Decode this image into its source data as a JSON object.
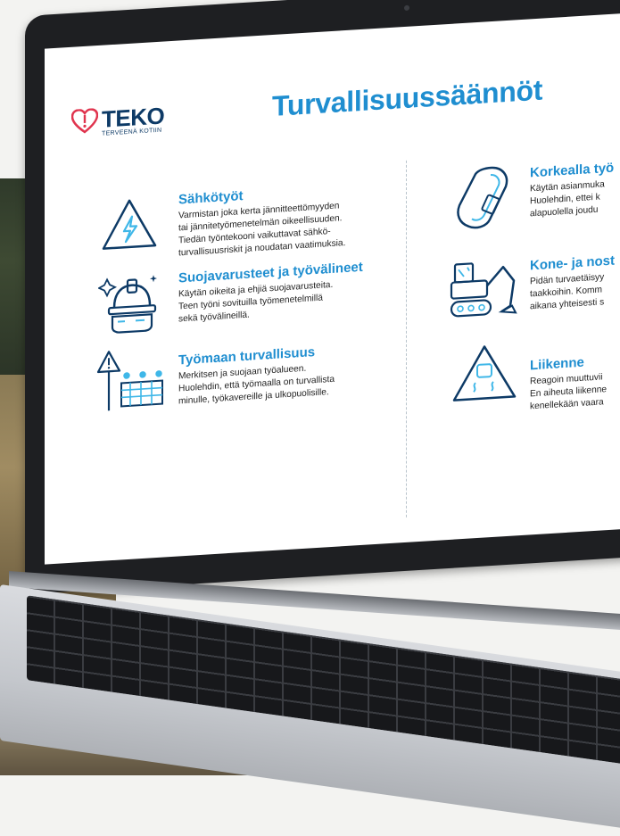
{
  "slide": {
    "logo": {
      "word": "TEKO",
      "tagline": "TERVEENÄ KOTIIN"
    },
    "title": "Turvallisuussäännöt",
    "left_column": [
      {
        "heading": "Sähkötyöt",
        "icon": "electric-hazard-icon",
        "lines": [
          "Varmistan joka kerta jännitteettömyyden",
          "tai jännitetyömenetelmän oikeellisuuden.",
          "Tiedän työntekooni vaikuttavat sähkö-",
          "turvallisuusriskit ja noudatan vaatimuksia."
        ]
      },
      {
        "heading": "Suojavarusteet ja työvälineet",
        "icon": "helmet-goggles-icon",
        "lines": [
          "Käytän oikeita ja ehjiä suojavarusteita.",
          "Teen työni sovituilla työmenetelmillä",
          "sekä työvälineillä."
        ]
      },
      {
        "heading": "Työmaan turvallisuus",
        "icon": "worksite-barrier-icon",
        "lines": [
          "Merkitsen ja suojaan työalueen.",
          "Huolehdin, että työmaalla on turvallista",
          "minulle, työkavereille ja ulkopuolisille."
        ]
      }
    ],
    "right_column": [
      {
        "heading": "Korkealla työ",
        "icon": "carabiner-icon",
        "lines": [
          "Käytän asianmuka",
          "Huolehdin, ettei k",
          "alapuolella joudu"
        ]
      },
      {
        "heading": "Kone- ja nost",
        "icon": "excavator-icon",
        "lines": [
          "Pidän turvaetäisyy",
          "taakkoihin. Komm",
          "aikana yhteisesti s"
        ]
      },
      {
        "heading": "Liikenne",
        "icon": "slippery-road-icon",
        "lines": [
          "Reagoin muuttuvii",
          "En aiheuta liikenne",
          "kenellekään vaara"
        ]
      }
    ]
  },
  "colors": {
    "accent": "#1f8ed0",
    "logo": "#0d3a66",
    "icon_stroke": "#0d3a66",
    "icon_highlight": "#3fb7e8",
    "laptop_bezel": "#1e1f22"
  }
}
